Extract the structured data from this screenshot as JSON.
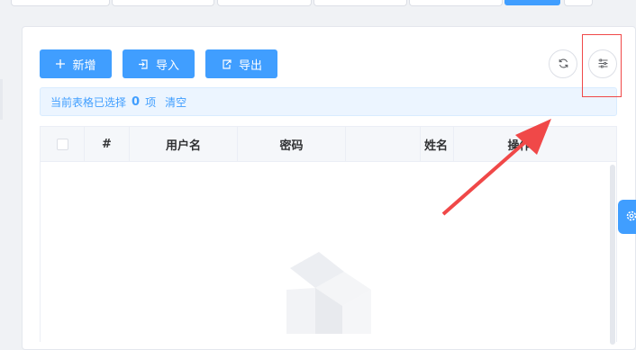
{
  "toolbar": {
    "add_label": "新增",
    "import_label": "导入",
    "export_label": "导出",
    "add_icon": "plus-icon",
    "import_icon": "import-icon",
    "export_icon": "export-icon",
    "refresh_icon": "refresh-icon",
    "columns_icon": "column-settings-icon"
  },
  "selection_alert": {
    "prefix": "当前表格已选择",
    "count": "0",
    "suffix": "项",
    "clear_label": "清空"
  },
  "table": {
    "columns": [
      "#",
      "用户名",
      "密码",
      "姓名",
      "操作"
    ]
  },
  "empty_state": {
    "icon": "empty-box-icon"
  },
  "side_tab": {
    "icon": "gear-icon"
  },
  "colors": {
    "primary": "#409eff",
    "annotation": "#f04848"
  }
}
